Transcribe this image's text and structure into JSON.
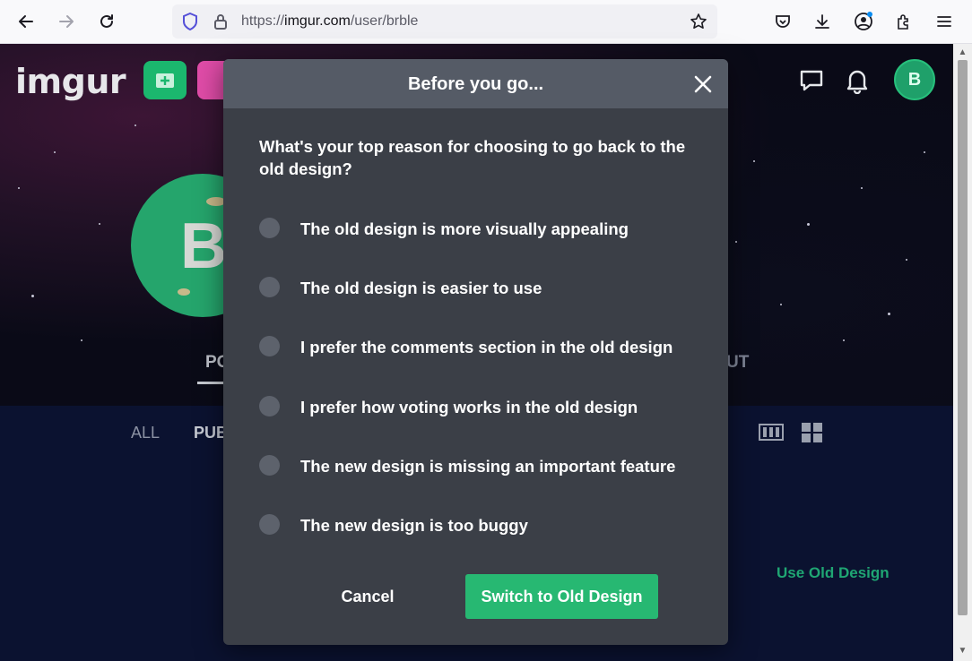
{
  "browser": {
    "url_scheme": "https://",
    "url_host": "imgur.com",
    "url_path": "/user/brble",
    "icons": [
      "back-arrow-icon",
      "forward-arrow-icon",
      "reload-icon",
      "shield-icon",
      "lock-icon",
      "star-icon",
      "pocket-icon",
      "download-icon",
      "account-icon",
      "extensions-icon",
      "menu-icon"
    ]
  },
  "site": {
    "logo": "imgur",
    "avatar_letter": "B",
    "profile_letter": "B",
    "tab_left": "PO",
    "tab_right": "UT",
    "filter_all": "ALL",
    "filter_public": "PUB",
    "use_old_design": "Use Old Design",
    "accent_color": "#1bb76e"
  },
  "modal": {
    "title": "Before you go...",
    "question": "What's your top reason for choosing to go back to the old design?",
    "options": [
      "The old design is more visually appealing",
      "The old design is easier to use",
      "I prefer the comments section in the old design",
      "I prefer how voting works in the old design",
      "The new design is missing an important feature",
      "The new design is too buggy"
    ],
    "cancel_label": "Cancel",
    "submit_label": "Switch to Old Design",
    "submit_color": "#27b872"
  }
}
